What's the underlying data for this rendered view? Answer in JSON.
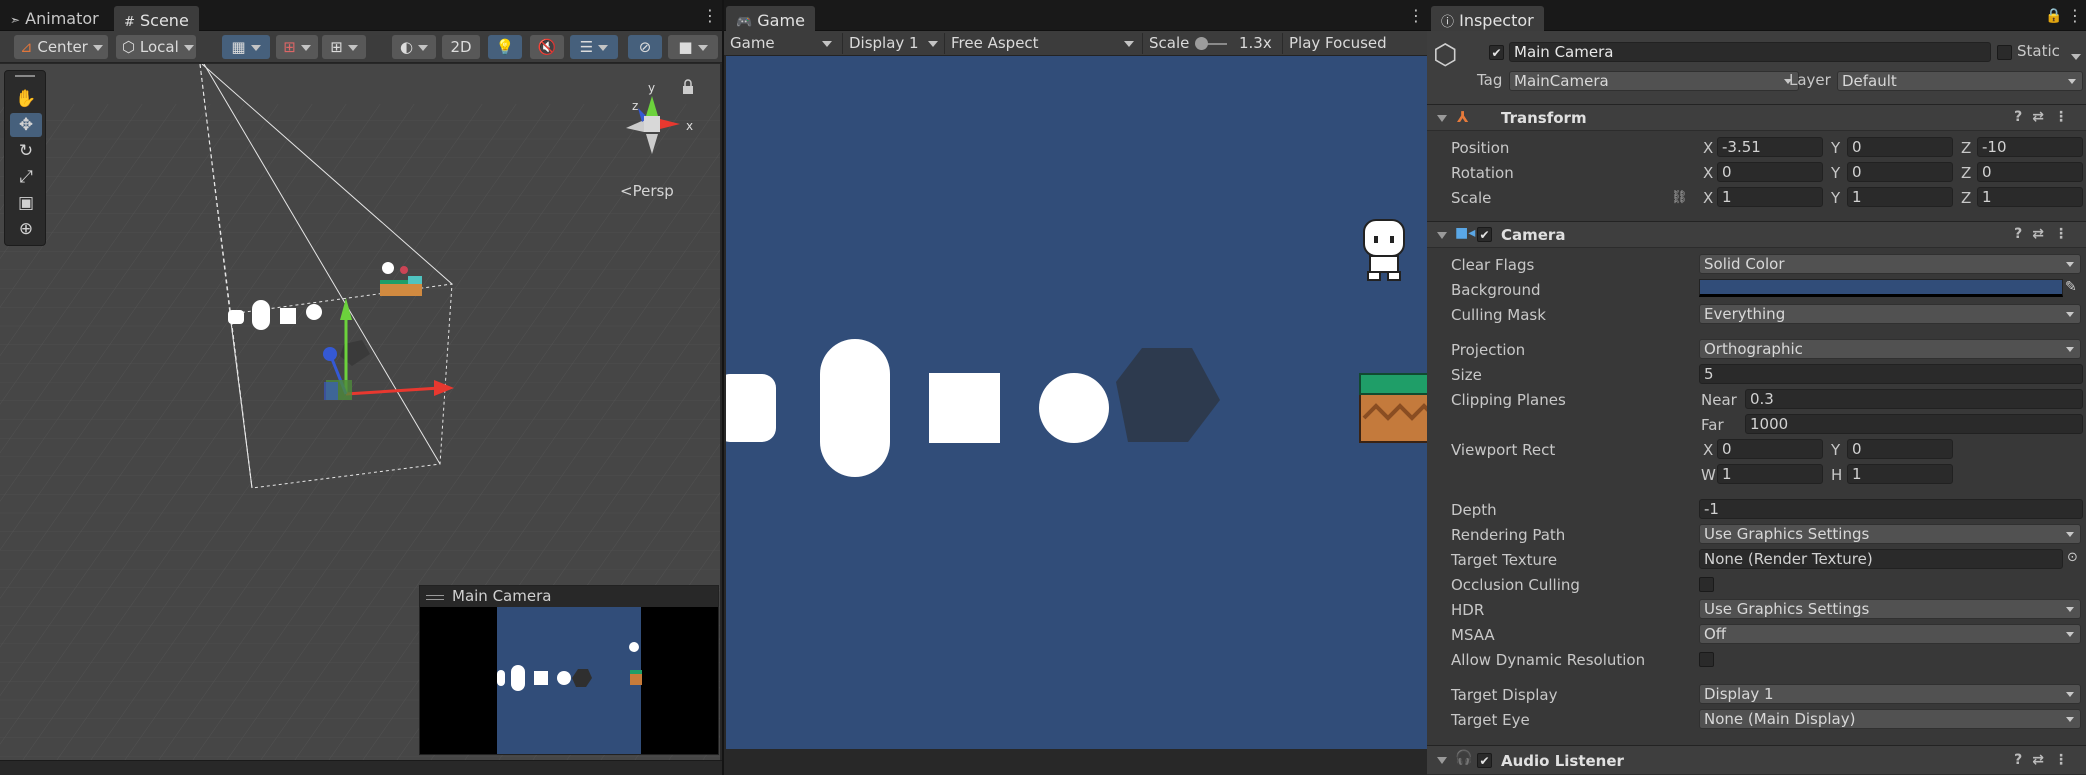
{
  "scene_panel": {
    "tabs": [
      {
        "icon": "animator-icon",
        "label": "Animator"
      },
      {
        "icon": "scene-grid-icon",
        "label": "Scene"
      }
    ],
    "toolbar": {
      "pivot": "Center",
      "space": "Local",
      "mode_2d": "2D"
    },
    "orientation_label": "Persp",
    "gizmo_axes": {
      "x": "x",
      "y": "y",
      "z": "z"
    },
    "camera_preview_title": "Main Camera"
  },
  "game_panel": {
    "tab_label": "Game",
    "toolbar": {
      "view": "Game",
      "display": "Display 1",
      "aspect": "Free Aspect",
      "scale_label": "Scale",
      "scale_value": "1.3x",
      "play_mode": "Play Focused"
    }
  },
  "inspector": {
    "tab_label": "Inspector",
    "object_name": "Main Camera",
    "active": true,
    "static_label": "Static",
    "tag_label": "Tag",
    "tag_value": "MainCamera",
    "layer_label": "Layer",
    "layer_value": "Default",
    "transform": {
      "title": "Transform",
      "position_label": "Position",
      "rotation_label": "Rotation",
      "scale_label": "Scale",
      "axis_x": "X",
      "axis_y": "Y",
      "axis_z": "Z",
      "position": {
        "x": "-3.51",
        "y": "0",
        "z": "-10"
      },
      "rotation": {
        "x": "0",
        "y": "0",
        "z": "0"
      },
      "scale": {
        "x": "1",
        "y": "1",
        "z": "1"
      }
    },
    "camera": {
      "title": "Camera",
      "clear_flags_label": "Clear Flags",
      "clear_flags": "Solid Color",
      "background_label": "Background",
      "background_color": "#314d79",
      "culling_mask_label": "Culling Mask",
      "culling_mask": "Everything",
      "projection_label": "Projection",
      "projection": "Orthographic",
      "size_label": "Size",
      "size": "5",
      "clipping_label": "Clipping Planes",
      "near_label": "Near",
      "near": "0.3",
      "far_label": "Far",
      "far": "1000",
      "viewport_label": "Viewport Rect",
      "vp_x_label": "X",
      "vp_y_label": "Y",
      "vp_w_label": "W",
      "vp_h_label": "H",
      "vp_x": "0",
      "vp_y": "0",
      "vp_w": "1",
      "vp_h": "1",
      "depth_label": "Depth",
      "depth": "-1",
      "rendering_path_label": "Rendering Path",
      "rendering_path": "Use Graphics Settings",
      "target_texture_label": "Target Texture",
      "target_texture": "None (Render Texture)",
      "occlusion_label": "Occlusion Culling",
      "hdr_label": "HDR",
      "hdr": "Use Graphics Settings",
      "msaa_label": "MSAA",
      "msaa": "Off",
      "dyn_res_label": "Allow Dynamic Resolution",
      "target_display_label": "Target Display",
      "target_display": "Display 1",
      "target_eye_label": "Target Eye",
      "target_eye": "None (Main Display)"
    },
    "audio_listener": {
      "title": "Audio Listener"
    }
  },
  "colors": {
    "panel": "#383838",
    "toolbar": "#3c3c3c",
    "scene_bg": "#474747",
    "game_bg": "#314d79",
    "accent_blue": "#46607c"
  }
}
